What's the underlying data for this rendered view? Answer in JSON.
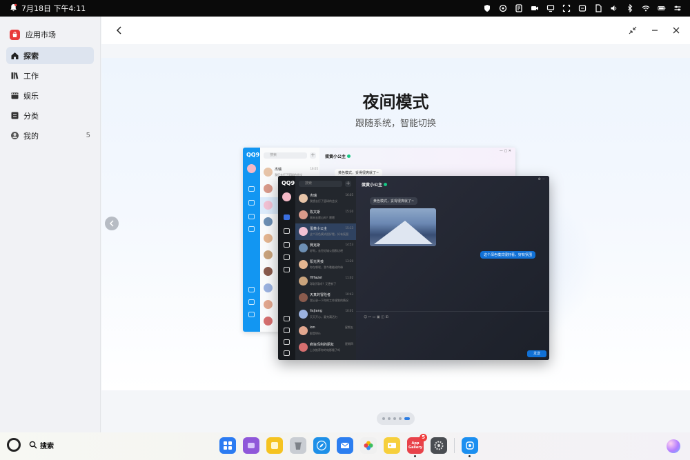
{
  "status_bar": {
    "date_time": "7月18日 下午4:11"
  },
  "sidebar": {
    "app_name": "应用市场",
    "items": [
      {
        "label": "探索",
        "icon": "home-icon",
        "active": true
      },
      {
        "label": "工作",
        "icon": "books-icon"
      },
      {
        "label": "娱乐",
        "icon": "clapper-icon"
      },
      {
        "label": "分类",
        "icon": "grid-list-icon"
      },
      {
        "label": "我的",
        "icon": "user-icon",
        "count": "5"
      }
    ]
  },
  "hero": {
    "title": "夜间模式",
    "subtitle": "跟随系统，智能切换",
    "light_chat": {
      "search": "搜索",
      "chat_title": "蛋黄小公主",
      "first_contact": {
        "name": "杰瑞",
        "preview": "我们去打了篮球的会议",
        "time": "16:05"
      },
      "bubble": "黄色模式，妥得很爽就了~"
    },
    "dark_chat": {
      "brand": "QQ9",
      "search": "搜索",
      "chat_title": "蛋黄小公主",
      "contacts": [
        {
          "name": "杰瑞",
          "preview": "我想去打了篮球的会议",
          "time": "16:05",
          "color": "#e7c4a8"
        },
        {
          "name": "陈文斯",
          "preview": "周末去爬山吗？嗯嗯",
          "time": "15:20",
          "color": "#d99a8a"
        },
        {
          "name": "蛋黄小公主",
          "preview": "这个深色模式很好看，好有氛围",
          "time": "15:13",
          "color": "#f2c1d4"
        },
        {
          "name": "赛克斯",
          "preview": "好呀，去世纪城公园那边吧",
          "time": "14:53",
          "color": "#6d8fb3"
        },
        {
          "name": "阳光男孩",
          "preview": "你在哪呢，我今晚能给你带",
          "time": "13:20",
          "color": "#e4b590"
        },
        {
          "name": "HHazel",
          "preview": "QQ好用吗？又更新了",
          "time": "11:02",
          "color": "#c9a37c"
        },
        {
          "name": "天真的冒险者",
          "preview": "我记录一下你的工作规划的情况",
          "time": "10:43",
          "color": "#8a5b4d"
        },
        {
          "name": "lixjiang",
          "preview": "天天开心，要充满活力",
          "time": "10:01",
          "color": "#9bb2e0"
        },
        {
          "name": "ion",
          "preview": "那是Win",
          "time": "星期五",
          "color": "#e2a78f"
        },
        {
          "name": "疯狂玛利的朋友",
          "preview": "上次推荐你的电影看了吗",
          "time": "星期四",
          "color": "#d66f6f"
        }
      ],
      "bubble_in": "黄色模式，妥得很爽就了~",
      "bubble_out": "这个深色模式很好看，好有氛围",
      "send": "发送"
    }
  },
  "dock": {
    "search_label": "搜索",
    "apps": [
      {
        "name": "app-grid",
        "color": "#2b7bf2",
        "label": ""
      },
      {
        "name": "app-purple",
        "color": "#8f57d9",
        "label": ""
      },
      {
        "name": "notes",
        "color": "#f5c320",
        "label": ""
      },
      {
        "name": "trash",
        "color": "#c9cdd3",
        "label": ""
      },
      {
        "name": "browser",
        "color": "#1e90e8",
        "label": ""
      },
      {
        "name": "mail",
        "color": "#2c7ef0",
        "label": ""
      },
      {
        "name": "photos",
        "color": "#f0f0f0",
        "label": ""
      },
      {
        "name": "contacts-card",
        "color": "#f6cf3c",
        "label": ""
      },
      {
        "name": "app-gallery",
        "color": "#e8424a",
        "label": "App Gallery",
        "badge": "5"
      },
      {
        "name": "settings",
        "color": "#4a4d52",
        "label": ""
      },
      {
        "name": "cloud",
        "color": "#1c8ff0",
        "label": ""
      }
    ]
  }
}
